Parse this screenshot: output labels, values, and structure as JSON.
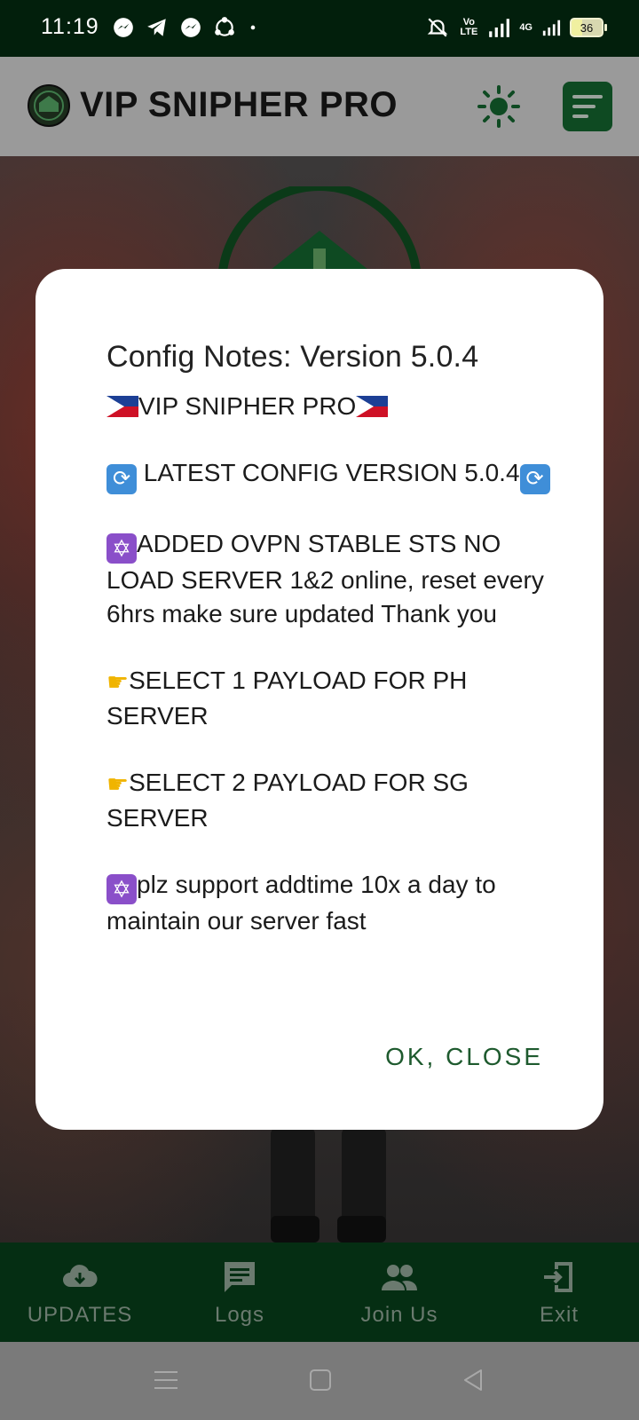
{
  "status_bar": {
    "time": "11:19",
    "network_type": "4G",
    "volte_label": "Vo LTE",
    "battery_level": "36"
  },
  "app_bar": {
    "title": "VIP SNIPHER PRO",
    "icons": [
      "logo-icon",
      "sun-icon",
      "menu-icon"
    ],
    "accent_color": "#0e4a22"
  },
  "dialog": {
    "title": "Config Notes: Version 5.0.4",
    "line_brand": "VIP SNIPHER PRO",
    "line_latest": " LATEST CONFIG VERSION 5.0.4",
    "line_added": "ADDED OVPN STABLE STS NO LOAD SERVER 1&2  online,  reset every 6hrs make sure updated Thank you",
    "line_select1": "SELECT 1 PAYLOAD FOR PH SERVER",
    "line_select2": "SELECT 2 PAYLOAD FOR SG SERVER",
    "line_support": "plz support addtime 10x a day to maintain our server fast",
    "ok_button": "OK, CLOSE"
  },
  "bottom_nav": {
    "items": [
      {
        "label": "UPDATES",
        "icon": "cloud-download-icon"
      },
      {
        "label": "Logs",
        "icon": "message-icon"
      },
      {
        "label": "Join Us",
        "icon": "group-icon"
      },
      {
        "label": "Exit",
        "icon": "exit-icon"
      }
    ]
  }
}
